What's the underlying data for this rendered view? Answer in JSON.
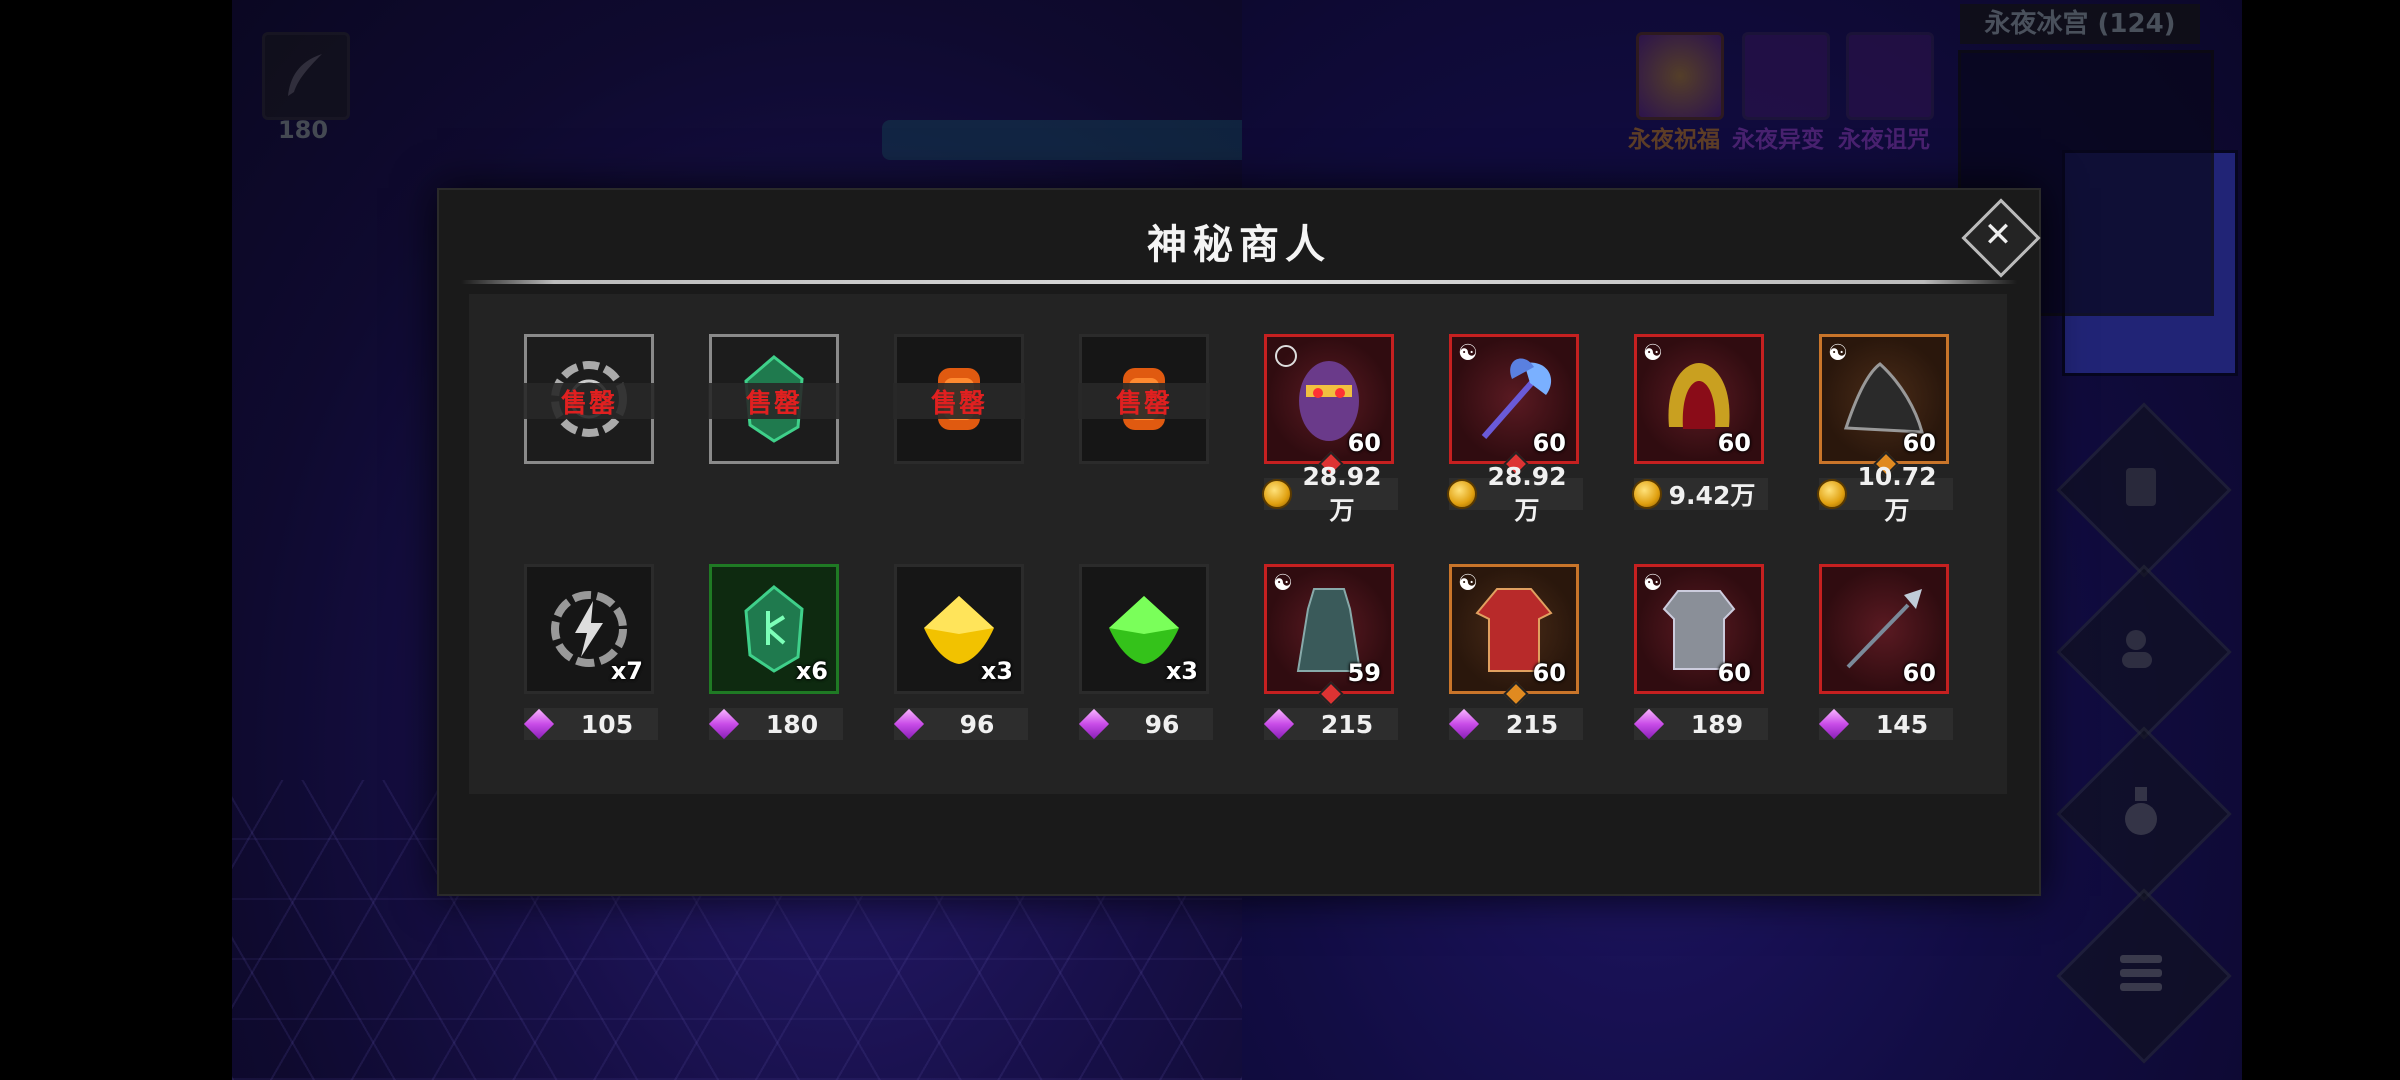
{
  "hud": {
    "item_count": "180",
    "buffs": [
      {
        "label": "永夜祝福",
        "color": "#d18a2a"
      },
      {
        "label": "永夜异变",
        "color": "#a048d8"
      },
      {
        "label": "永夜诅咒",
        "color": "#a048d8"
      }
    ],
    "map_title": "永夜冰宫 (124)",
    "side_buttons": [
      "scroll-icon",
      "friends-icon",
      "potion-icon",
      "menu-list-icon"
    ]
  },
  "shop": {
    "title": "神秘商人",
    "sold_label": "售罄",
    "row1": [
      {
        "kind": "rune-ring",
        "sold": true
      },
      {
        "kind": "green-rune-stone",
        "sold": true
      },
      {
        "kind": "orange-lantern",
        "sold": true
      },
      {
        "kind": "orange-lantern",
        "sold": true
      },
      {
        "kind": "demon-mask",
        "level": "60",
        "quality": "red",
        "price": "28.92万",
        "currency": "coin",
        "gemdot": "#d33"
      },
      {
        "kind": "battle-axe",
        "level": "60",
        "quality": "red",
        "price": "28.92万",
        "currency": "coin",
        "gemdot": "#d33"
      },
      {
        "kind": "golden-helm",
        "level": "60",
        "quality": "red",
        "price": "9.42万",
        "currency": "coin"
      },
      {
        "kind": "dark-cloak",
        "level": "60",
        "quality": "orange",
        "price": "10.72万",
        "currency": "coin",
        "gemdot": "#e08a20"
      }
    ],
    "row2": [
      {
        "kind": "lightning-rune",
        "qty": "x7",
        "quality": "dark",
        "price": "105",
        "currency": "gem"
      },
      {
        "kind": "green-rune-stone",
        "qty": "x6",
        "quality": "green",
        "price": "180",
        "currency": "gem"
      },
      {
        "kind": "yellow-gem",
        "qty": "x3",
        "quality": "dark",
        "price": "96",
        "currency": "gem"
      },
      {
        "kind": "green-gem",
        "qty": "x3",
        "quality": "dark",
        "price": "96",
        "currency": "gem"
      },
      {
        "kind": "hooded-robe",
        "level": "59",
        "quality": "red",
        "price": "215",
        "currency": "gem",
        "gemdot": "#d33"
      },
      {
        "kind": "red-robe",
        "level": "60",
        "quality": "orange",
        "price": "215",
        "currency": "gem",
        "gemdot": "#e08a20"
      },
      {
        "kind": "steel-armor",
        "level": "60",
        "quality": "red",
        "price": "189",
        "currency": "gem"
      },
      {
        "kind": "spear",
        "level": "60",
        "quality": "red",
        "price": "145",
        "currency": "gem"
      }
    ]
  }
}
